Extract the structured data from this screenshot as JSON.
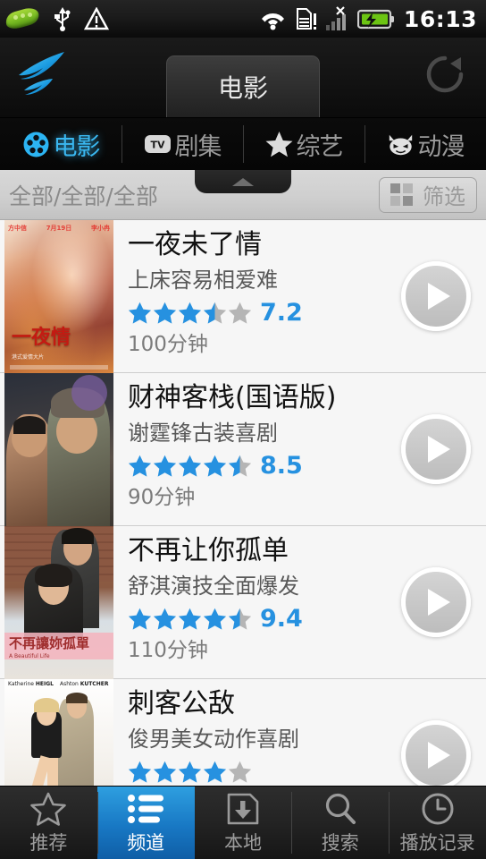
{
  "statusbar": {
    "time": "16:13",
    "icons": [
      "peapod-icon",
      "usb-icon",
      "warning-icon",
      "wifi-icon",
      "sdcard-alert-icon",
      "signal-no-sim-icon",
      "battery-charging-icon"
    ]
  },
  "header": {
    "logo": "swift-bird-logo",
    "title": "电影",
    "refresh": "refresh-icon"
  },
  "category_tabs": [
    {
      "label": "电影",
      "icon": "film-reel-icon",
      "active": true
    },
    {
      "label": "剧集",
      "icon": "tv-icon",
      "active": false
    },
    {
      "label": "综艺",
      "icon": "star-icon",
      "active": false
    },
    {
      "label": "动漫",
      "icon": "devil-face-icon",
      "active": false
    }
  ],
  "filterbar": {
    "current": "全部/全部/全部",
    "filter_label": "筛选",
    "filter_icon": "grid-icon",
    "collapse_icon": "chevron-up-icon"
  },
  "list": [
    {
      "title": "一夜未了情",
      "subtitle": "上床容易相爱难",
      "rating": 7.2,
      "stars": 3.5,
      "duration": "100分钟",
      "play_icon": "play-icon"
    },
    {
      "title": "财神客栈(国语版)",
      "subtitle": "谢霆锋古装喜剧",
      "rating": 8.5,
      "stars": 4.5,
      "duration": "90分钟",
      "play_icon": "play-icon"
    },
    {
      "title": "不再让你孤单",
      "subtitle": "舒淇演技全面爆发",
      "rating": 9.4,
      "stars": 4.5,
      "duration": "110分钟",
      "play_icon": "play-icon"
    },
    {
      "title": "刺客公敌",
      "subtitle": "俊男美女动作喜剧",
      "rating": null,
      "stars": 4,
      "duration": "",
      "play_icon": "play-icon"
    }
  ],
  "bottom_nav": [
    {
      "label": "推荐",
      "icon": "star-outline-icon",
      "active": false
    },
    {
      "label": "频道",
      "icon": "list-icon",
      "active": true
    },
    {
      "label": "本地",
      "icon": "download-icon",
      "active": false
    },
    {
      "label": "搜索",
      "icon": "search-icon",
      "active": false
    },
    {
      "label": "播放记录",
      "icon": "clock-icon",
      "active": false
    }
  ],
  "colors": {
    "accent_blue": "#2691e0",
    "tab_active_blue": "#3ab7f0",
    "star_blue": "#2691e0",
    "star_empty": "#b5b5b5"
  }
}
